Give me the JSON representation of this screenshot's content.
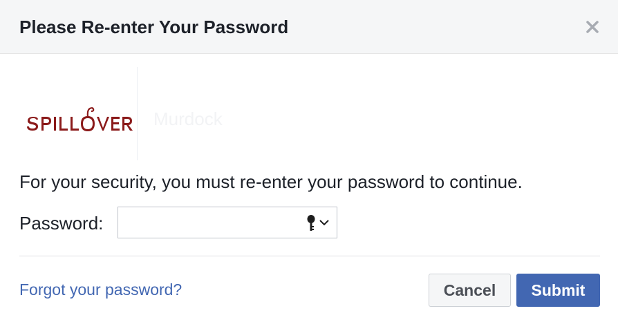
{
  "dialog": {
    "title": "Please Re-enter Your Password",
    "close_icon": "close-icon"
  },
  "profile": {
    "logo_text": "SPILLOVER",
    "logo_color": "#8b1a1a",
    "name": "Murdock"
  },
  "message": "For your security, you must re-enter your password to continue.",
  "password": {
    "label": "Password:",
    "value": "",
    "placeholder": "",
    "key_icon": "key-icon",
    "dropdown_icon": "chevron-down-icon"
  },
  "footer": {
    "forgot_link": "Forgot your password?",
    "cancel_label": "Cancel",
    "submit_label": "Submit"
  },
  "colors": {
    "header_bg": "#f5f6f7",
    "link": "#4267b2",
    "submit_bg": "#4267b2",
    "text": "#1d2129"
  }
}
